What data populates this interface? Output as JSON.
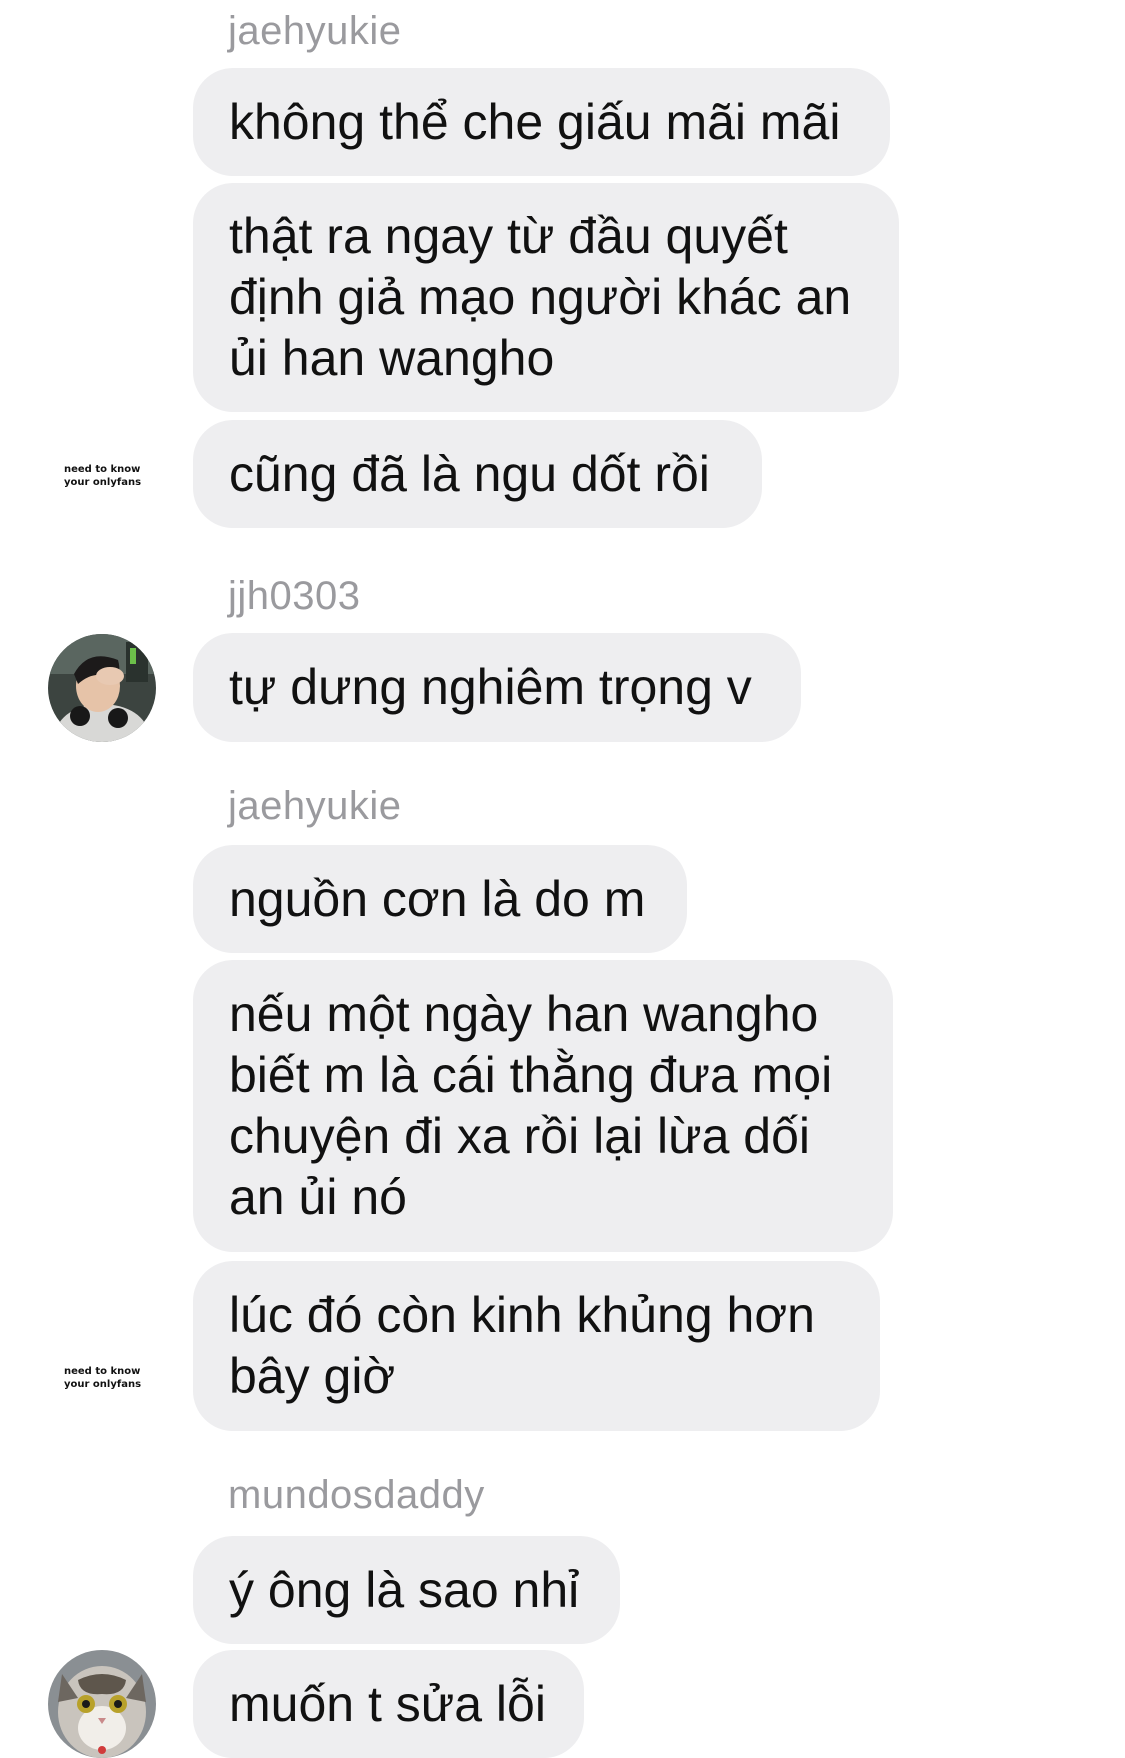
{
  "groups": [
    {
      "username": "jaehyukie",
      "caption": [
        "need to know",
        "your onlyfans"
      ],
      "messages": [
        {
          "lines": [
            "không thể che giấu mãi mãi"
          ]
        },
        {
          "lines": [
            "thật ra ngay từ đầu quyết",
            "định giả mạo người khác an",
            "ủi han wangho"
          ]
        },
        {
          "lines": [
            "cũng đã là ngu dốt rồi"
          ]
        }
      ]
    },
    {
      "username": "jjh0303",
      "avatar": "person-holding-head-avatar",
      "messages": [
        {
          "lines": [
            "tự dưng nghiêm trọng v"
          ]
        }
      ]
    },
    {
      "username": "jaehyukie",
      "caption": [
        "need to know",
        "your onlyfans"
      ],
      "messages": [
        {
          "lines": [
            "nguồn cơn là do m"
          ]
        },
        {
          "lines": [
            "nếu một ngày han wangho",
            "biết m là cái thằng đưa mọi",
            "chuyện đi xa rồi lại lừa dối",
            "an ủi nó"
          ]
        },
        {
          "lines": [
            "lúc đó còn kinh khủng hơn",
            "bây giờ"
          ]
        }
      ]
    },
    {
      "username": "mundosdaddy",
      "avatar": "cat-avatar",
      "messages": [
        {
          "lines": [
            "ý ông là sao nhỉ"
          ]
        },
        {
          "lines": [
            "muốn t sửa lỗi"
          ]
        }
      ]
    }
  ]
}
